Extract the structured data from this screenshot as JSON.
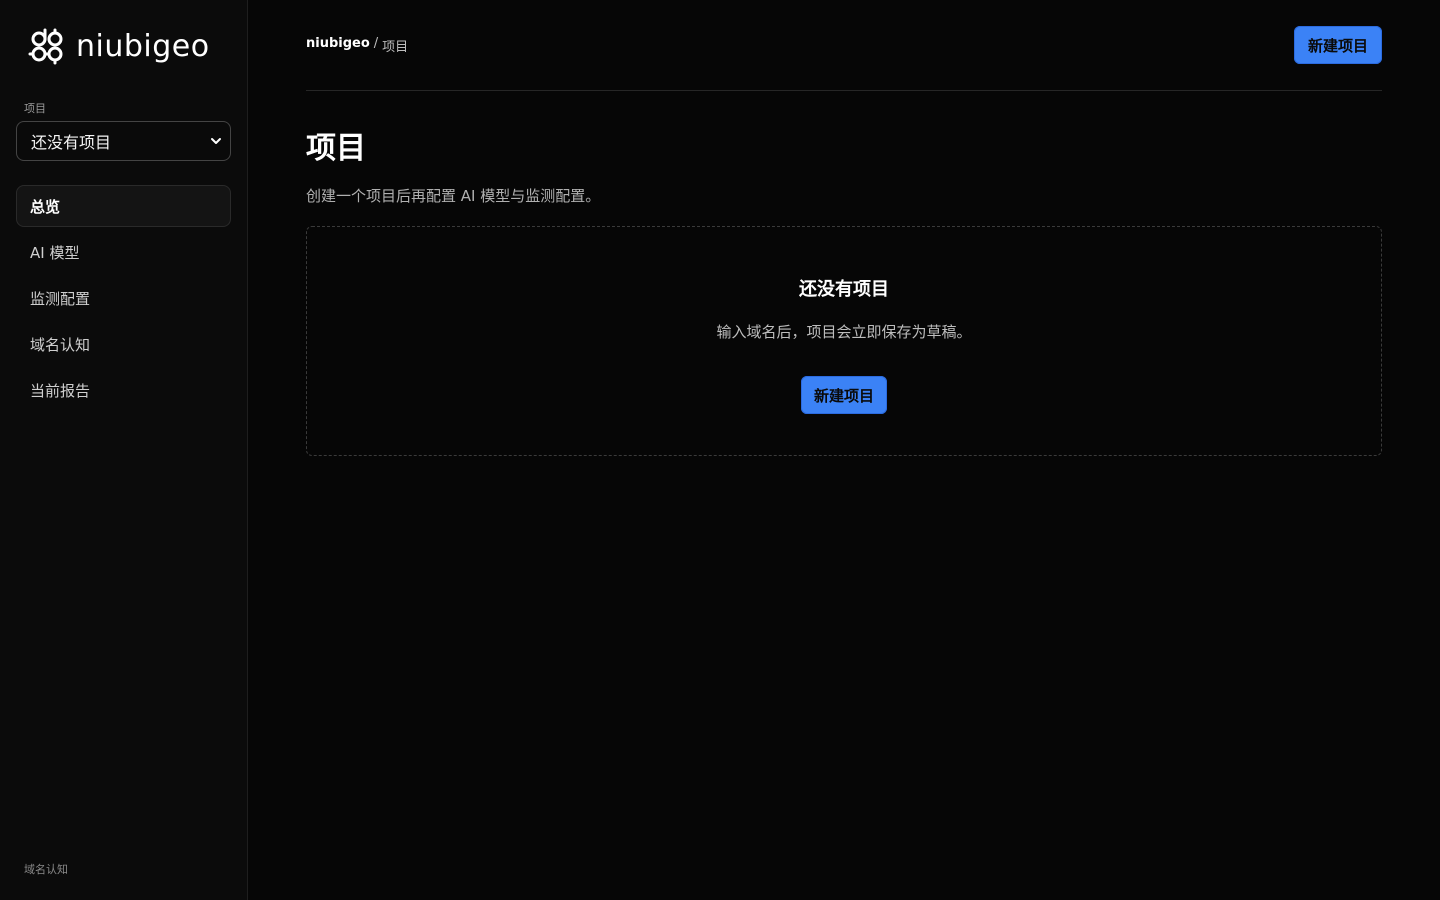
{
  "brand": {
    "name": "niubigeo"
  },
  "sidebar": {
    "section_label": "项目",
    "project_select": {
      "value": "还没有项目"
    },
    "items": [
      {
        "label": "总览",
        "active": true
      },
      {
        "label": "AI 模型",
        "active": false
      },
      {
        "label": "监测配置",
        "active": false
      },
      {
        "label": "域名认知",
        "active": false
      },
      {
        "label": "当前报告",
        "active": false
      }
    ],
    "footer": "域名认知"
  },
  "header": {
    "breadcrumb": {
      "root": "niubigeo",
      "separator": "/",
      "current": "项目"
    },
    "new_project_label": "新建项目"
  },
  "main": {
    "title": "项目",
    "subtitle": "创建一个项目后再配置 AI 模型与监测配置。",
    "empty_state": {
      "title": "还没有项目",
      "description": "输入域名后，项目会立即保存为草稿。",
      "button_label": "新建项目"
    }
  },
  "colors": {
    "accent": "#3b82f6",
    "background": "#060606",
    "sidebar": "#0b0b0b"
  }
}
